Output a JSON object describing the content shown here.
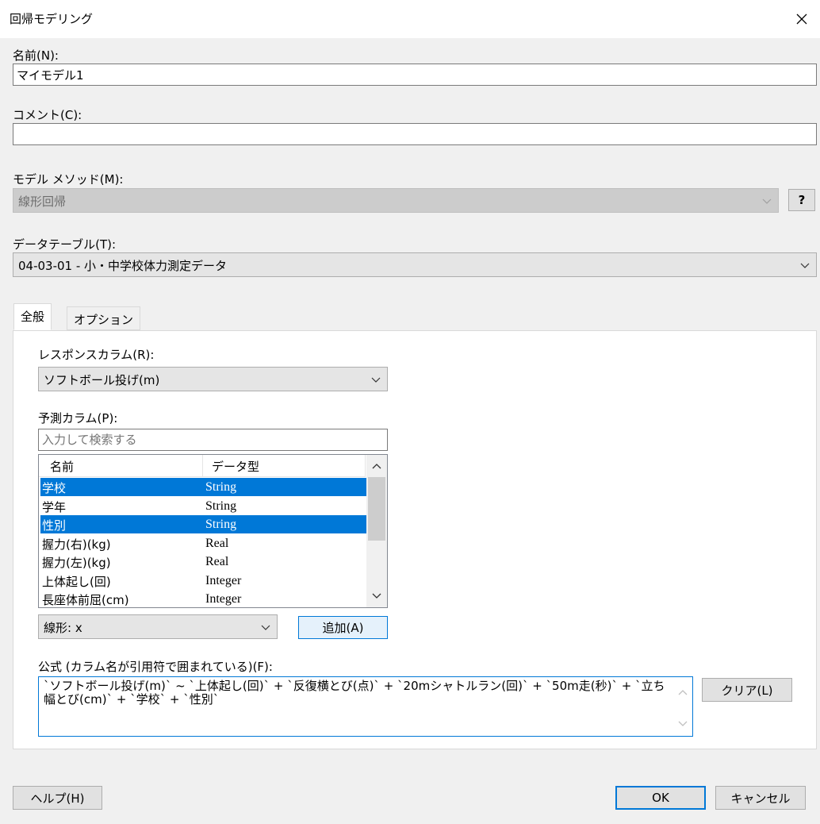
{
  "window": {
    "title": "回帰モデリング"
  },
  "name": {
    "label": "名前(N):",
    "value": "マイモデル1"
  },
  "comment": {
    "label": "コメント(C):",
    "value": ""
  },
  "method": {
    "label": "モデル メソッド(M):",
    "value": "線形回帰",
    "help_label": "?"
  },
  "datatable": {
    "label": "データテーブル(T):",
    "value": "04-03-01 - 小・中学校体力測定データ"
  },
  "tabs": [
    {
      "label": "全般"
    },
    {
      "label": "オプション"
    }
  ],
  "response": {
    "label": "レスポンスカラム(R):",
    "value": "ソフトボール投げ(m)"
  },
  "predictors": {
    "label": "予測カラム(P):",
    "search_placeholder": "入力して検索する",
    "columns": [
      "名前",
      "データ型"
    ],
    "rows": [
      {
        "name": "学校",
        "type": "String",
        "selected": true
      },
      {
        "name": "学年",
        "type": "String",
        "selected": false
      },
      {
        "name": "性別",
        "type": "String",
        "selected": true
      },
      {
        "name": "握力(右)(kg)",
        "type": "Real",
        "selected": false
      },
      {
        "name": "握力(左)(kg)",
        "type": "Real",
        "selected": false
      },
      {
        "name": "上体起し(回)",
        "type": "Integer",
        "selected": false
      },
      {
        "name": "長座体前屈(cm)",
        "type": "Integer",
        "selected": false
      }
    ]
  },
  "term": {
    "value": "線形: x",
    "add_label": "追加(A)"
  },
  "formula": {
    "label": "公式 (カラム名が引用符で囲まれている)(F):",
    "value": "`ソフトボール投げ(m)` ~ `上体起し(回)` + `反復横とび(点)` + `20mシャトルラン(回)` + `50m走(秒)` + `立ち幅とび(cm)` + `学校` + `性別`",
    "clear_label": "クリア(L)"
  },
  "footer": {
    "help_label": "ヘルプ(H)",
    "ok_label": "OK",
    "cancel_label": "キャンセル"
  },
  "colors": {
    "accent": "#0078d7",
    "background": "#f0f0f0"
  },
  "icons": [
    "close-icon",
    "chevron-down-icon",
    "chevron-up-icon"
  ]
}
